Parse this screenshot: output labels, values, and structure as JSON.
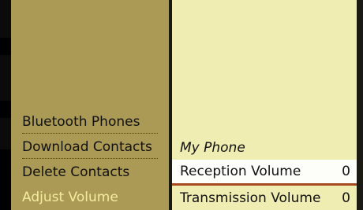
{
  "menu": {
    "items": [
      {
        "label": "Bluetooth Phones"
      },
      {
        "label": "Download Contacts"
      },
      {
        "label": "Delete Contacts"
      },
      {
        "label": "Adjust Volume"
      }
    ]
  },
  "detail": {
    "title": "My Phone",
    "rows": [
      {
        "label": "Reception Volume",
        "value": "0"
      },
      {
        "label": "Transmission Volume",
        "value": "0"
      }
    ]
  },
  "colors": {
    "menu_background": "#ab9a55",
    "list_background": "#efedb2",
    "active_text": "#f3ec9d",
    "selection_underline": "#a54a1e"
  }
}
